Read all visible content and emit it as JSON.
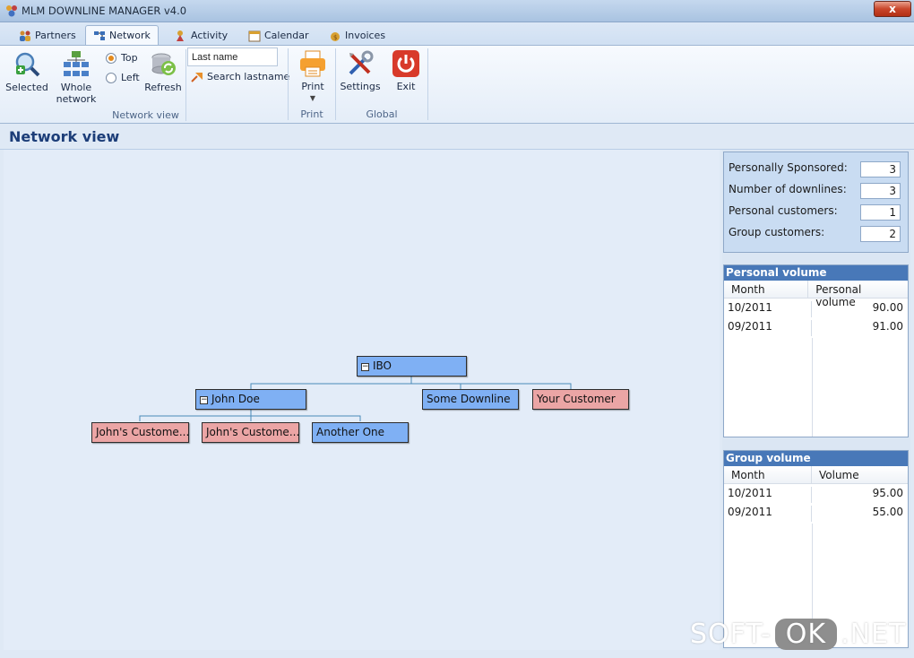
{
  "window": {
    "title": "MLM DOWNLINE MANAGER v4.0",
    "close": "x"
  },
  "tabs": [
    {
      "label": "Partners",
      "icon": "partners-icon"
    },
    {
      "label": "Network",
      "icon": "network-icon"
    },
    {
      "label": "Activity",
      "icon": "activity-icon"
    },
    {
      "label": "Calendar",
      "icon": "calendar-icon"
    },
    {
      "label": "Invoices",
      "icon": "invoices-icon"
    }
  ],
  "ribbon": {
    "selected": "Selected",
    "whole": "Whole network",
    "top": "Top",
    "left": "Left",
    "refresh": "Refresh",
    "lastname_value": "Last name",
    "search_lastname": "Search lastname",
    "print": "Print",
    "settings": "Settings",
    "exit": "Exit",
    "groups": {
      "network_view": "Network view",
      "print": "Print",
      "global": "Global"
    }
  },
  "section_title": "Network view",
  "tree": {
    "root": "IBO",
    "john_doe": "John Doe",
    "some_downline": "Some Downline",
    "your_customer": "Your Customer",
    "johns_customer_1": "John's Custome...",
    "johns_customer_2": "John's Custome...",
    "another_one": "Another One"
  },
  "stats": {
    "personally_sponsored_label": "Personally Sponsored:",
    "personally_sponsored": "3",
    "downlines_label": "Number of downlines:",
    "downlines": "3",
    "personal_customers_label": "Personal customers:",
    "personal_customers": "1",
    "group_customers_label": "Group customers:",
    "group_customers": "2"
  },
  "personal_volume": {
    "title": "Personal volume",
    "col_month": "Month",
    "col_value": "Personal volume",
    "rows": [
      {
        "month": "10/2011",
        "value": "90.00"
      },
      {
        "month": "09/2011",
        "value": "91.00"
      }
    ]
  },
  "group_volume": {
    "title": "Group volume",
    "col_month": "Month",
    "col_value": "Volume",
    "rows": [
      {
        "month": "10/2011",
        "value": "95.00"
      },
      {
        "month": "09/2011",
        "value": "55.00"
      }
    ]
  },
  "watermark": {
    "left": "SOFT-",
    "ok": "OK",
    "right": ".NET"
  },
  "colors": {
    "node_blue": "#7fb0f4",
    "node_pink": "#eba5a5",
    "panel_header": "#4878b8",
    "title_blue": "#1c3d78"
  }
}
